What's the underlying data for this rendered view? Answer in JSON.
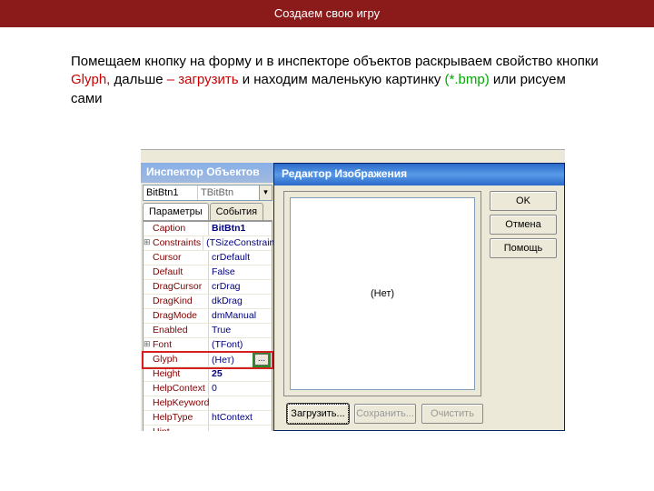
{
  "header": {
    "title": "Создаем свою игру"
  },
  "instruction": {
    "part1": "Помещаем кнопку на форму и в инспекторе объектов раскрываем свойство кнопки ",
    "glyph": "Glyph,",
    "part2": " дальше ",
    "load": "– загрузить",
    "part3": " и находим маленькую картинку ",
    "bmp": "(*.bmp)",
    "part4": " или рисуем сами"
  },
  "inspector": {
    "title": "Инспектор Объектов",
    "combo": {
      "name": "BitBtn1",
      "type": "TBitBtn"
    },
    "tabs": {
      "params": "Параметры",
      "events": "События"
    },
    "props": [
      {
        "key": "Caption",
        "val": "BitBtn1",
        "expand": false,
        "bold": true
      },
      {
        "key": "Constraints",
        "val": "(TSizeConstrain",
        "expand": true,
        "bold": false
      },
      {
        "key": "Cursor",
        "val": "crDefault",
        "expand": false,
        "bold": false
      },
      {
        "key": "Default",
        "val": "False",
        "expand": false,
        "bold": false
      },
      {
        "key": "DragCursor",
        "val": "crDrag",
        "expand": false,
        "bold": false
      },
      {
        "key": "DragKind",
        "val": "dkDrag",
        "expand": false,
        "bold": false
      },
      {
        "key": "DragMode",
        "val": "dmManual",
        "expand": false,
        "bold": false
      },
      {
        "key": "Enabled",
        "val": "True",
        "expand": false,
        "bold": false
      },
      {
        "key": "Font",
        "val": "(TFont)",
        "expand": true,
        "bold": false
      },
      {
        "key": "Glyph",
        "val": "(Нет)",
        "expand": false,
        "bold": false,
        "glyph": true
      },
      {
        "key": "Height",
        "val": "25",
        "expand": false,
        "bold": true
      },
      {
        "key": "HelpContext",
        "val": "0",
        "expand": false,
        "bold": false
      },
      {
        "key": "HelpKeyword",
        "val": "",
        "expand": false,
        "bold": false
      },
      {
        "key": "HelpType",
        "val": "htContext",
        "expand": false,
        "bold": false
      },
      {
        "key": "Hint",
        "val": "",
        "expand": false,
        "bold": false
      }
    ],
    "ellipsis": "..."
  },
  "dialog": {
    "title": "Редактор Изображения",
    "canvas_placeholder": "(Нет)",
    "buttons": {
      "ok": "OK",
      "cancel": "Отмена",
      "help": "Помощь"
    },
    "bottom": {
      "load": "Загрузить...",
      "save": "Сохранить...",
      "clear": "Очистить"
    }
  }
}
